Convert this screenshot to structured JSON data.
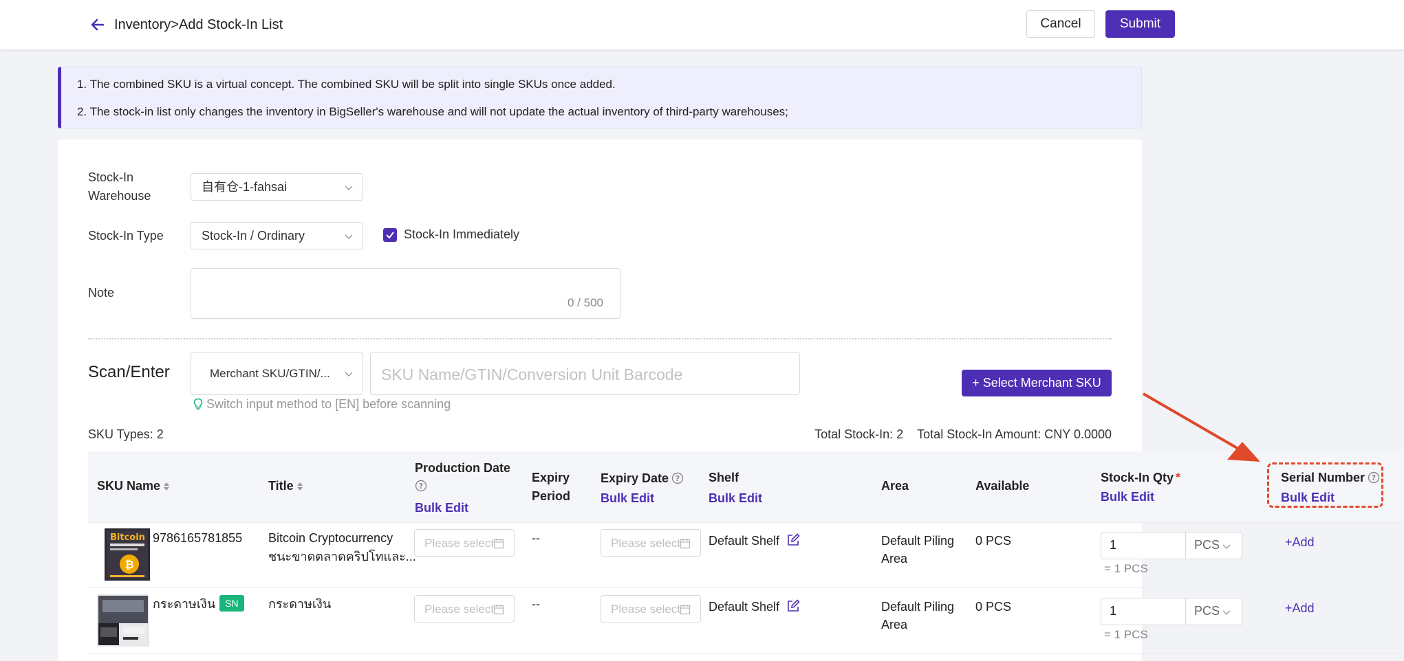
{
  "header": {
    "breadcrumb": "Inventory>Add Stock-In List",
    "cancel_label": "Cancel",
    "submit_label": "Submit"
  },
  "notice": {
    "line1": "1. The combined SKU is a virtual concept. The combined SKU will be split into single SKUs once added.",
    "line2": "2. The stock-in list only changes the inventory in BigSeller's warehouse and will not update the actual inventory of third-party warehouses;"
  },
  "form": {
    "warehouse_label_line1": "Stock-In",
    "warehouse_label_line2": "Warehouse",
    "warehouse_value": "自有仓-1-fahsai",
    "type_label": "Stock-In Type",
    "type_value": "Stock-In / Ordinary",
    "immediate_label": "Stock-In Immediately",
    "immediate_checked": true,
    "note_label": "Note",
    "note_count": "0 / 500"
  },
  "scan": {
    "label": "Scan/Enter",
    "method_value": "Merchant SKU/GTIN/...",
    "placeholder": "SKU Name/GTIN/Conversion Unit Barcode",
    "hint": "Switch input method to [EN] before scanning",
    "select_button": "+ Select Merchant SKU"
  },
  "summary": {
    "sku_types": "SKU Types: 2",
    "total_stock_in": "Total Stock-In: 2",
    "total_amount": "Total Stock-In Amount: CNY  0.0000"
  },
  "table": {
    "headers": {
      "sku_name": "SKU Name",
      "title": "Title",
      "production_date": "Production Date",
      "expiry_period_l1": "Expiry",
      "expiry_period_l2": "Period",
      "expiry_date": "Expiry Date",
      "shelf": "Shelf",
      "area": "Area",
      "available": "Available",
      "stock_in_qty": "Stock-In Qty",
      "serial_number": "Serial Number",
      "bulk_edit": "Bulk Edit"
    },
    "rows": [
      {
        "sku": "9786165781855",
        "title_l1": "Bitcoin Cryptocurrency",
        "title_l2": "ชนะขาดตลาดคริปโทและ...",
        "date_placeholder": "Please select",
        "expiry_period": "--",
        "shelf": "Default Shelf",
        "area_l1": "Default Piling",
        "area_l2": "Area",
        "available": "0 PCS",
        "qty": "1",
        "unit": "PCS",
        "eq": "= 1 PCS",
        "add": "+Add"
      },
      {
        "sku": "กระดาษเงิน",
        "badge": "SN",
        "title_l1": "กระดาษเงิน",
        "date_placeholder": "Please select",
        "expiry_period": "--",
        "shelf": "Default Shelf",
        "area_l1": "Default Piling",
        "area_l2": "Area",
        "available": "0 PCS",
        "qty": "1",
        "unit": "PCS",
        "eq": "= 1 PCS",
        "add": "+Add"
      }
    ]
  },
  "colors": {
    "accent": "#4d2fb5",
    "highlight": "#e04a2a",
    "sn_badge": "#18b67a"
  }
}
